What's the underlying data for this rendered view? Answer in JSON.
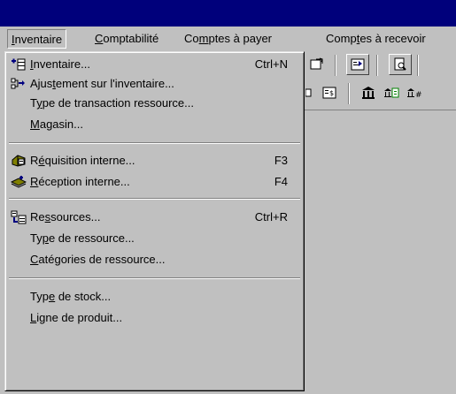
{
  "menubar": {
    "items": [
      {
        "pre": "",
        "ul": "I",
        "post": "nventaire"
      },
      {
        "pre": "",
        "ul": "C",
        "post": "omptabilité"
      },
      {
        "pre": "Co",
        "ul": "m",
        "post": "ptes à payer"
      },
      {
        "pre": "Comp",
        "ul": "t",
        "post": "es à recevoir"
      }
    ]
  },
  "menu": {
    "items": [
      {
        "pre": "",
        "ul": "I",
        "post": "nventaire...",
        "shortcut": "Ctrl+N",
        "icon": "new-inventory-icon"
      },
      {
        "pre": "Ajus",
        "ul": "t",
        "post": "ement sur l'inventaire...",
        "shortcut": "",
        "icon": "inventory-adjustment-icon"
      },
      {
        "pre": "T",
        "ul": "y",
        "post": "pe de transaction ressource...",
        "shortcut": "",
        "icon": ""
      },
      {
        "pre": "",
        "ul": "M",
        "post": "agasin...",
        "shortcut": "",
        "icon": ""
      },
      {
        "pre": "R",
        "ul": "é",
        "post": "quisition interne...",
        "shortcut": "F3",
        "icon": "internal-requisition-icon"
      },
      {
        "pre": "",
        "ul": "R",
        "post": "éception interne...",
        "shortcut": "F4",
        "icon": "internal-reception-icon"
      },
      {
        "pre": "Re",
        "ul": "s",
        "post": "sources...",
        "shortcut": "Ctrl+R",
        "icon": "resources-icon"
      },
      {
        "pre": "Ty",
        "ul": "p",
        "post": "e de ressource...",
        "shortcut": "",
        "icon": ""
      },
      {
        "pre": "",
        "ul": "C",
        "post": "atégories de ressource...",
        "shortcut": "",
        "icon": ""
      },
      {
        "pre": "Typ",
        "ul": "e",
        "post": " de stock...",
        "shortcut": "",
        "icon": ""
      },
      {
        "pre": "",
        "ul": "L",
        "post": "igne de produit...",
        "shortcut": "",
        "icon": ""
      }
    ]
  },
  "colors": {
    "titlebar": "#00007b",
    "face": "#c0c0c0"
  }
}
